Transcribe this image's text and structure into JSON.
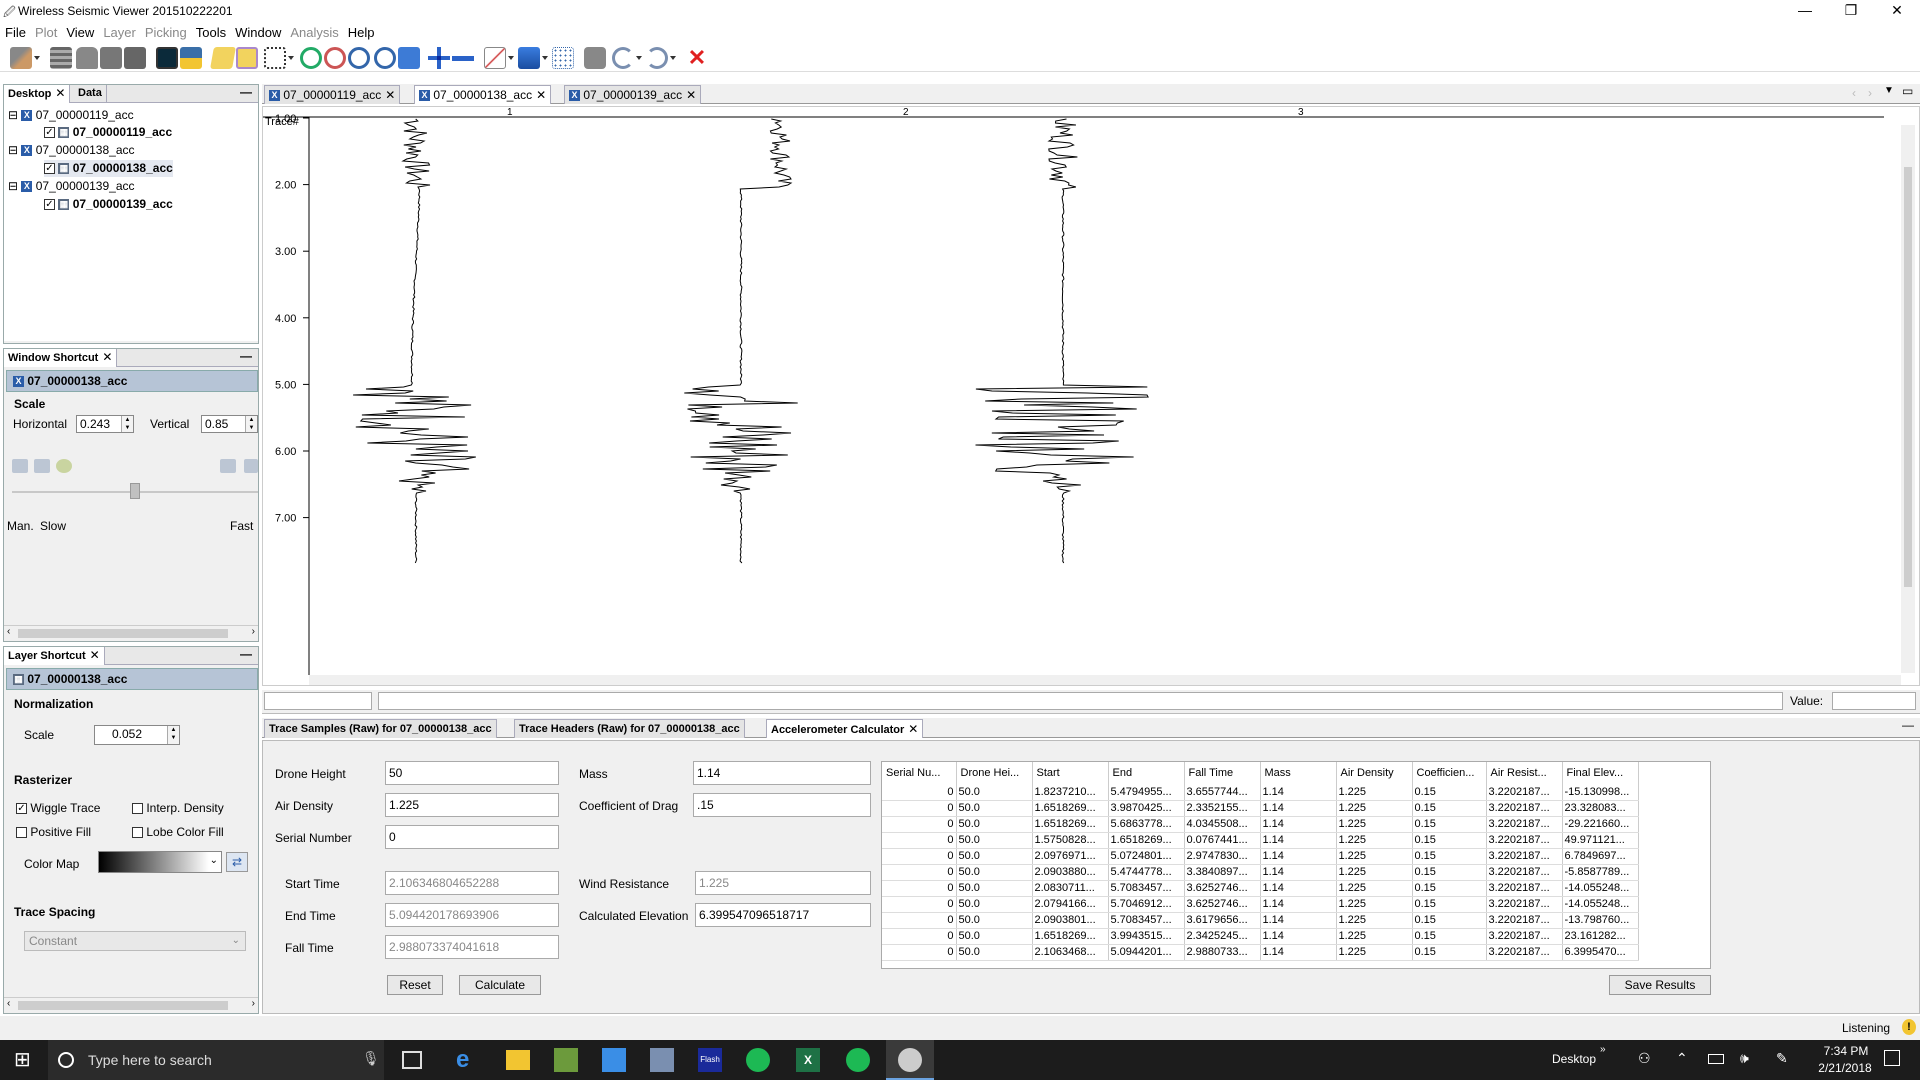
{
  "window": {
    "title": "Wireless Seismic Viewer 201510222201",
    "minimize": "—",
    "restore": "❐",
    "close": "✕"
  },
  "menu": [
    {
      "label": "File",
      "enabled": true
    },
    {
      "label": "Plot",
      "enabled": false
    },
    {
      "label": "View",
      "enabled": true
    },
    {
      "label": "Layer",
      "enabled": false
    },
    {
      "label": "Picking",
      "enabled": false
    },
    {
      "label": "Tools",
      "enabled": true
    },
    {
      "label": "Window",
      "enabled": true
    },
    {
      "label": "Analysis",
      "enabled": false
    },
    {
      "label": "Help",
      "enabled": true
    }
  ],
  "desktop_panel": {
    "tabs": [
      "Desktop",
      "Data"
    ],
    "tree": [
      {
        "parent": "07_00000119_acc",
        "child": "07_00000119_acc"
      },
      {
        "parent": "07_00000138_acc",
        "child": "07_00000138_acc"
      },
      {
        "parent": "07_00000139_acc",
        "child": "07_00000139_acc"
      }
    ]
  },
  "window_shortcut": {
    "title": "Window Shortcut",
    "selected": "07_00000138_acc",
    "scale_label": "Scale",
    "horizontal_label": "Horizontal",
    "horizontal_value": "0.243",
    "vertical_label": "Vertical",
    "vertical_value": "0.85",
    "speed_labels": {
      "man": "Man.",
      "slow": "Slow",
      "fast": "Fast"
    },
    "slider_level": 0.5
  },
  "layer_shortcut": {
    "title": "Layer Shortcut",
    "selected": "07_00000138_acc",
    "normalization_label": "Normalization",
    "scale_label": "Scale",
    "scale_value": "0.052",
    "rasterizer_label": "Rasterizer",
    "wiggle_trace": "Wiggle Trace",
    "wiggle_checked": true,
    "interp_density": "Interp. Density",
    "positive_fill": "Positive Fill",
    "lobe_color_fill": "Lobe Color Fill",
    "color_map_label": "Color Map",
    "trace_spacing_label": "Trace Spacing",
    "trace_spacing_value": "Constant"
  },
  "doc_tabs": [
    {
      "label": "07_00000119_acc",
      "active": false
    },
    {
      "label": "07_00000138_acc",
      "active": true
    },
    {
      "label": "07_00000139_acc",
      "active": false
    }
  ],
  "plot": {
    "y_header": "Trace#",
    "trace_labels": [
      "1",
      "2",
      "3"
    ],
    "y_ticks": [
      "1.00",
      "2.00",
      "3.00",
      "4.00",
      "5.00",
      "6.00",
      "7.00"
    ],
    "value_label": "Value:"
  },
  "bottom_tabs": [
    {
      "label": "Trace Samples (Raw) for 07_00000138_acc",
      "active": false
    },
    {
      "label": "Trace Headers (Raw) for 07_00000138_acc",
      "active": false
    },
    {
      "label": "Accelerometer Calculator",
      "active": true
    }
  ],
  "calc": {
    "drone_height_label": "Drone Height",
    "drone_height": "50",
    "air_density_label": "Air Density",
    "air_density": "1.225",
    "serial_number_label": "Serial Number",
    "serial_number": "0",
    "mass_label": "Mass",
    "mass": "1.14",
    "coef_drag_label": "Coefficient of Drag",
    "coef_drag": ".15",
    "start_time_label": "Start Time",
    "start_time": "2.106346804652288",
    "end_time_label": "End Time",
    "end_time": "5.094420178693906",
    "fall_time_label": "Fall Time",
    "fall_time": "2.988073374041618",
    "wind_resistance_label": "Wind Resistance",
    "wind_resistance": "1.225",
    "calc_elevation_label": "Calculated Elevation",
    "calc_elevation": "6.399547096518717",
    "reset": "Reset",
    "calculate": "Calculate",
    "save_results": "Save Results"
  },
  "results": {
    "headers": [
      "Serial Nu...",
      "Drone Hei...",
      "Start",
      "End",
      "Fall Time",
      "Mass",
      "Air Density",
      "Coefficien...",
      "Air Resist...",
      "Final Elev..."
    ],
    "rows": [
      [
        "0",
        "50.0",
        "1.8237210...",
        "5.4794955...",
        "3.6557744...",
        "1.14",
        "1.225",
        "0.15",
        "3.2202187...",
        "-15.130998..."
      ],
      [
        "0",
        "50.0",
        "1.6518269...",
        "3.9870425...",
        "2.3352155...",
        "1.14",
        "1.225",
        "0.15",
        "3.2202187...",
        "23.328083..."
      ],
      [
        "0",
        "50.0",
        "1.6518269...",
        "5.6863778...",
        "4.0345508...",
        "1.14",
        "1.225",
        "0.15",
        "3.2202187...",
        "-29.221660..."
      ],
      [
        "0",
        "50.0",
        "1.5750828...",
        "1.6518269...",
        "0.0767441...",
        "1.14",
        "1.225",
        "0.15",
        "3.2202187...",
        "49.971121..."
      ],
      [
        "0",
        "50.0",
        "2.0976971...",
        "5.0724801...",
        "2.9747830...",
        "1.14",
        "1.225",
        "0.15",
        "3.2202187...",
        "6.7849697..."
      ],
      [
        "0",
        "50.0",
        "2.0903880...",
        "5.4744778...",
        "3.3840897...",
        "1.14",
        "1.225",
        "0.15",
        "3.2202187...",
        "-5.8587789..."
      ],
      [
        "0",
        "50.0",
        "2.0830711...",
        "5.7083457...",
        "3.6252746...",
        "1.14",
        "1.225",
        "0.15",
        "3.2202187...",
        "-14.055248..."
      ],
      [
        "0",
        "50.0",
        "2.0794166...",
        "5.7046912...",
        "3.6252746...",
        "1.14",
        "1.225",
        "0.15",
        "3.2202187...",
        "-14.055248..."
      ],
      [
        "0",
        "50.0",
        "2.0903801...",
        "5.7083457...",
        "3.6179656...",
        "1.14",
        "1.225",
        "0.15",
        "3.2202187...",
        "-13.798760..."
      ],
      [
        "0",
        "50.0",
        "1.6518269...",
        "3.9943515...",
        "2.3425245...",
        "1.14",
        "1.225",
        "0.15",
        "3.2202187...",
        "23.161282..."
      ],
      [
        "0",
        "50.0",
        "2.1063468...",
        "5.0944201...",
        "2.9880733...",
        "1.14",
        "1.225",
        "0.15",
        "3.2202187...",
        "6.3995470..."
      ]
    ]
  },
  "status": {
    "listening": "Listening"
  },
  "taskbar": {
    "search_placeholder": "Type here to search",
    "desktop_label": "Desktop",
    "time": "7:34 PM",
    "date": "2/21/2018"
  }
}
